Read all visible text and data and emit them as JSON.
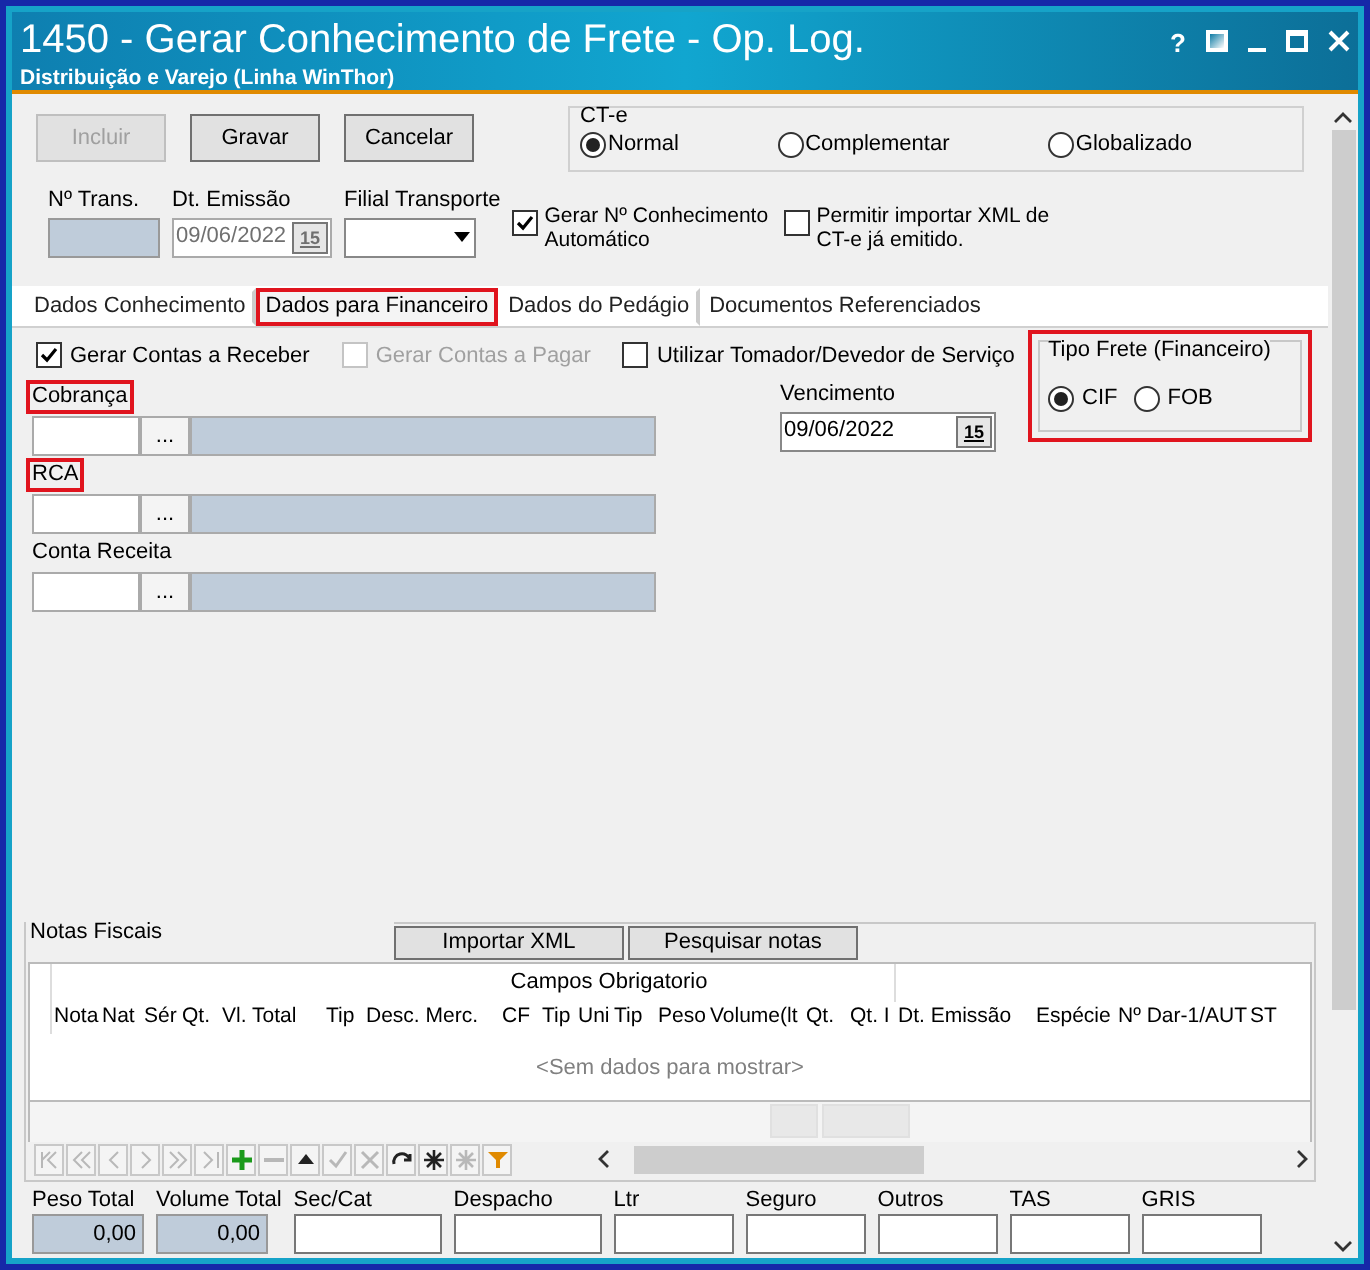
{
  "window": {
    "title": "1450 - Gerar Conhecimento de Frete - Op. Log.",
    "subtitle": "Distribuição e Varejo (Linha WinThor)",
    "controls": [
      "?"
    ]
  },
  "toolbar": [
    {
      "label": "Incluir",
      "disabled": true
    },
    {
      "label": "Gravar",
      "disabled": false
    },
    {
      "label": "Cancelar",
      "disabled": false
    }
  ],
  "cte": {
    "title": "CT-e",
    "options": [
      {
        "label": "Normal",
        "selected": true
      },
      {
        "label": "Complementar",
        "selected": false
      },
      {
        "label": "Globalizado",
        "selected": false
      }
    ]
  },
  "header_fields": {
    "trans_label": "Nº Trans.",
    "emissao_label": "Dt. Emissão",
    "emissao_value": "09/06/2022",
    "filial_label": "Filial Transporte",
    "calendar_glyph": "15"
  },
  "header_checks": [
    {
      "label": "Gerar Nº Conhecimento Automático",
      "checked": true
    },
    {
      "label": "Permitir importar XML de CT-e já emitido.",
      "checked": false
    }
  ],
  "tabs": [
    {
      "label": "Dados Conhecimento",
      "selected": false,
      "highlighted": false
    },
    {
      "label": "Dados para Financeiro",
      "selected": true,
      "highlighted": true
    },
    {
      "label": "Dados do Pedágio",
      "selected": false,
      "highlighted": false
    },
    {
      "label": "Documentos Referenciados",
      "selected": false,
      "highlighted": false
    }
  ],
  "financeiro": {
    "checks": [
      {
        "label": "Gerar Contas a Receber",
        "checked": true,
        "disabled": false
      },
      {
        "label": "Gerar Contas a Pagar",
        "checked": false,
        "disabled": true
      },
      {
        "label": "Utilizar Tomador/Devedor de Serviço",
        "checked": false,
        "disabled": false
      }
    ],
    "lookups": [
      {
        "label": "Cobrança",
        "highlighted": true,
        "button": "..."
      },
      {
        "label": "RCA",
        "highlighted": true,
        "button": "..."
      },
      {
        "label": "Conta Receita",
        "highlighted": false,
        "button": "..."
      }
    ],
    "vencimento_label": "Vencimento",
    "vencimento_value": "09/06/2022",
    "calendar_glyph": "15",
    "tipo_frete": {
      "title": "Tipo Frete (Financeiro)",
      "highlighted": true,
      "options": [
        {
          "label": "CIF",
          "selected": true
        },
        {
          "label": "FOB",
          "selected": false
        }
      ]
    }
  },
  "notas": {
    "title": "Notas Fiscais",
    "buttons": [
      "Importar XML",
      "Pesquisar notas"
    ],
    "group_header": "Campos Obrigatorio",
    "columns": [
      "Nota",
      "Nat",
      "Sér",
      "Qt.",
      "Vl. Total",
      "Tip",
      "Desc. Merc.",
      "CF",
      "Tip",
      "Uni",
      "Tip",
      "Peso",
      "Volume(lt",
      "Qt.",
      "Qt. I",
      "Dt. Emissão",
      "Espécie",
      "Nº Dar-1/AUT",
      "ST"
    ],
    "empty_text": "<Sem dados para mostrar>"
  },
  "navigator": [
    {
      "kind": "first",
      "disabled": true
    },
    {
      "kind": "prev-page",
      "disabled": true
    },
    {
      "kind": "prev",
      "disabled": true
    },
    {
      "kind": "next",
      "disabled": true
    },
    {
      "kind": "next-page",
      "disabled": true
    },
    {
      "kind": "last",
      "disabled": true
    },
    {
      "kind": "add",
      "disabled": false
    },
    {
      "kind": "remove",
      "disabled": true
    },
    {
      "kind": "up",
      "disabled": false
    },
    {
      "kind": "confirm",
      "disabled": true
    },
    {
      "kind": "cancel",
      "disabled": true
    },
    {
      "kind": "refresh",
      "disabled": false
    },
    {
      "kind": "star",
      "disabled": false
    },
    {
      "kind": "star",
      "disabled": true
    },
    {
      "kind": "filter",
      "disabled": false
    }
  ],
  "totals": [
    {
      "label": "Peso Total",
      "value": "0,00",
      "readonly": true
    },
    {
      "label": "Volume Total",
      "value": "0,00",
      "readonly": true
    },
    {
      "label": "Sec/Cat",
      "readonly": false
    },
    {
      "label": "Despacho",
      "readonly": false
    },
    {
      "label": "Ltr",
      "readonly": false
    },
    {
      "label": "Seguro",
      "readonly": false
    },
    {
      "label": "Outros",
      "readonly": false
    },
    {
      "label": "TAS",
      "readonly": false
    },
    {
      "label": "GRIS",
      "readonly": false
    }
  ]
}
